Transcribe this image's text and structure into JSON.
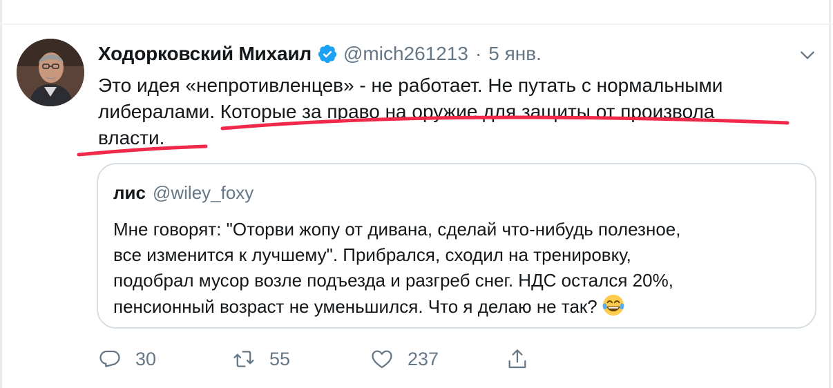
{
  "tweet": {
    "author": {
      "name": "Ходорковский Михаил",
      "handle": "@mich261213",
      "verified": true,
      "verified_color": "#1da1f2"
    },
    "separator": "·",
    "date": "5 янв.",
    "text_lines": [
      "Это идея «непротивленцев» - не работает. Не путать с нормальными",
      "либералами. Которые за право на оружие для защиты от произвола",
      "власти."
    ],
    "annotation_color": "#f0284a",
    "quote": {
      "author_name": "лис",
      "author_handle": "@wiley_foxy",
      "text_lines": [
        "Мне говорят: \"Оторви жопу  от дивана, сделай что-нибудь полезное,",
        "все изменится к лучшему\". Прибрался, сходил на тренировку,",
        "подобрал мусор возле подъезда и разгреб снег. НДС остался 20%,",
        "пенсионный возраст не уменьшился. Что я делаю не так?"
      ],
      "emoji": "face-with-tears-of-joy"
    },
    "actions": {
      "reply_count": "30",
      "retweet_count": "55",
      "like_count": "237"
    }
  },
  "icons": {
    "verified": "verified-badge-icon",
    "menu": "chevron-down-icon",
    "reply": "reply-icon",
    "retweet": "retweet-icon",
    "like": "heart-icon",
    "share": "share-icon"
  },
  "colors": {
    "text_primary": "#14171a",
    "text_secondary": "#657786",
    "border": "#d7dee3"
  }
}
